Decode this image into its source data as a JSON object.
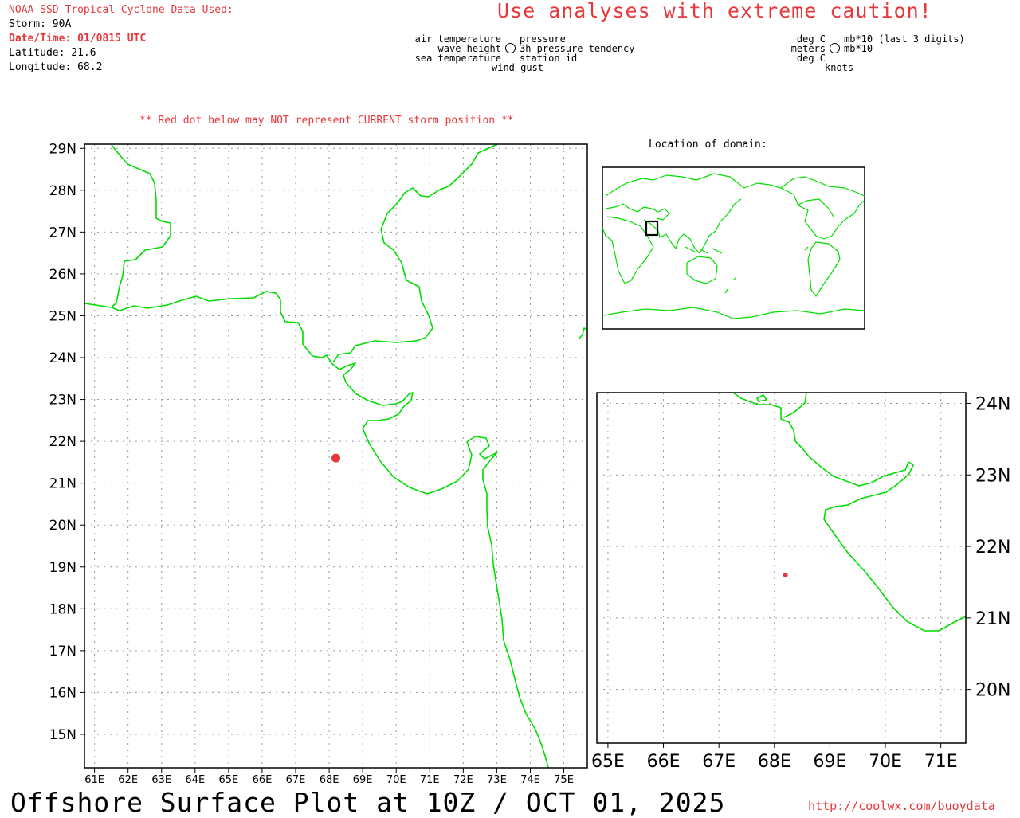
{
  "header": {
    "source": "NOAA SSD Tropical Cyclone Data Used:",
    "storm": "Storm: 90A",
    "datetime": "Date/Time: 01/0815 UTC",
    "latitude": "Latitude: 21.6",
    "longitude": "Longitude: 68.2"
  },
  "caution": "Use analyses with extreme caution!",
  "legend": {
    "left": [
      "air temperature",
      "wave height",
      "sea temperature"
    ],
    "right": [
      "pressure",
      "3h pressure tendency",
      "station id"
    ],
    "bottom": "wind gust",
    "units_left": [
      "deg C",
      "meters",
      "deg C"
    ],
    "units_right": [
      "mb*10 (last 3 digits)",
      "mb*10"
    ],
    "units_bottom": "knots"
  },
  "note": "** Red dot below may NOT represent CURRENT storm position **",
  "inset": {
    "title": "Location of domain:"
  },
  "main_map": {
    "lat_labels": [
      "29N",
      "28N",
      "27N",
      "26N",
      "25N",
      "24N",
      "23N",
      "22N",
      "21N",
      "20N",
      "19N",
      "18N",
      "17N",
      "16N",
      "15N"
    ],
    "lon_labels": [
      "61E",
      "62E",
      "63E",
      "64E",
      "65E",
      "66E",
      "67E",
      "68E",
      "69E",
      "70E",
      "71E",
      "72E",
      "73E",
      "74E",
      "75E"
    ],
    "storm_position": {
      "lat": 21.6,
      "lon": 68.2
    }
  },
  "zoom_map": {
    "lat_labels": [
      "24N",
      "23N",
      "22N",
      "21N",
      "20N"
    ],
    "lon_labels": [
      "65E",
      "66E",
      "67E",
      "68E",
      "69E",
      "70E",
      "71E"
    ],
    "storm_position": {
      "lat": 21.6,
      "lon": 68.2
    }
  },
  "colors": {
    "coast": "#00dd00",
    "storm": "#e8383b",
    "grid": "#999999"
  },
  "footer": {
    "title": "Offshore Surface Plot at 10Z / OCT 01, 2025",
    "url": "http://coolwx.com/buoydata"
  }
}
